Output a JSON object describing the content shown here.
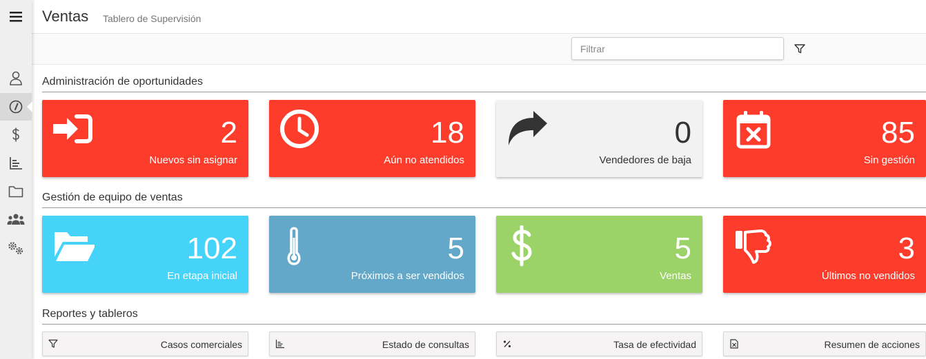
{
  "header": {
    "title": "Ventas",
    "subtitle": "Tablero de Supervisión"
  },
  "filter": {
    "placeholder": "Filtrar",
    "value": ""
  },
  "sidebar": {
    "items": [
      {
        "icon": "menu-icon"
      },
      {
        "icon": "user-icon"
      },
      {
        "icon": "dashboard-icon",
        "active": true
      },
      {
        "icon": "dollar-icon"
      },
      {
        "icon": "chart-icon"
      },
      {
        "icon": "folder-icon"
      },
      {
        "icon": "users-icon"
      },
      {
        "icon": "gears-icon"
      }
    ]
  },
  "sections": {
    "opportunities": "Administración de oportunidades",
    "team": "Gestión de equipo de ventas",
    "reports": "Reportes y tableros"
  },
  "cards": {
    "opportunities": [
      {
        "value": "2",
        "label": "Nuevos sin asignar",
        "icon": "sign-in-icon",
        "color": "#fd3c2c"
      },
      {
        "value": "18",
        "label": "Aún no atendidos",
        "icon": "clock-icon",
        "color": "#fd3c2c"
      },
      {
        "value": "0",
        "label": "Vendedores de baja",
        "icon": "share-arrow-icon",
        "color": "#f2f2f2"
      },
      {
        "value": "85",
        "label": "Sin gestión",
        "icon": "calendar-x-icon",
        "color": "#fd3c2c"
      }
    ],
    "team": [
      {
        "value": "102",
        "label": "En etapa inicial",
        "icon": "folder-open-icon",
        "color": "#45d3f9"
      },
      {
        "value": "5",
        "label": "Próximos a ser vendidos",
        "icon": "thermometer-icon",
        "color": "#63a8c8"
      },
      {
        "value": "5",
        "label": "Ventas",
        "icon": "dollar-sign-icon",
        "color": "#9cd369"
      },
      {
        "value": "3",
        "label": "Últimos no vendidos",
        "icon": "thumbs-down-icon",
        "color": "#fd3c2c"
      }
    ]
  },
  "reports": [
    {
      "label": "Casos comerciales",
      "icon": "filter-icon"
    },
    {
      "label": "Estado de consultas",
      "icon": "bar-chart-icon"
    },
    {
      "label": "Tasa de efectividad",
      "icon": "percent-icon"
    },
    {
      "label": "Resumen de acciones",
      "icon": "file-excel-icon"
    }
  ]
}
